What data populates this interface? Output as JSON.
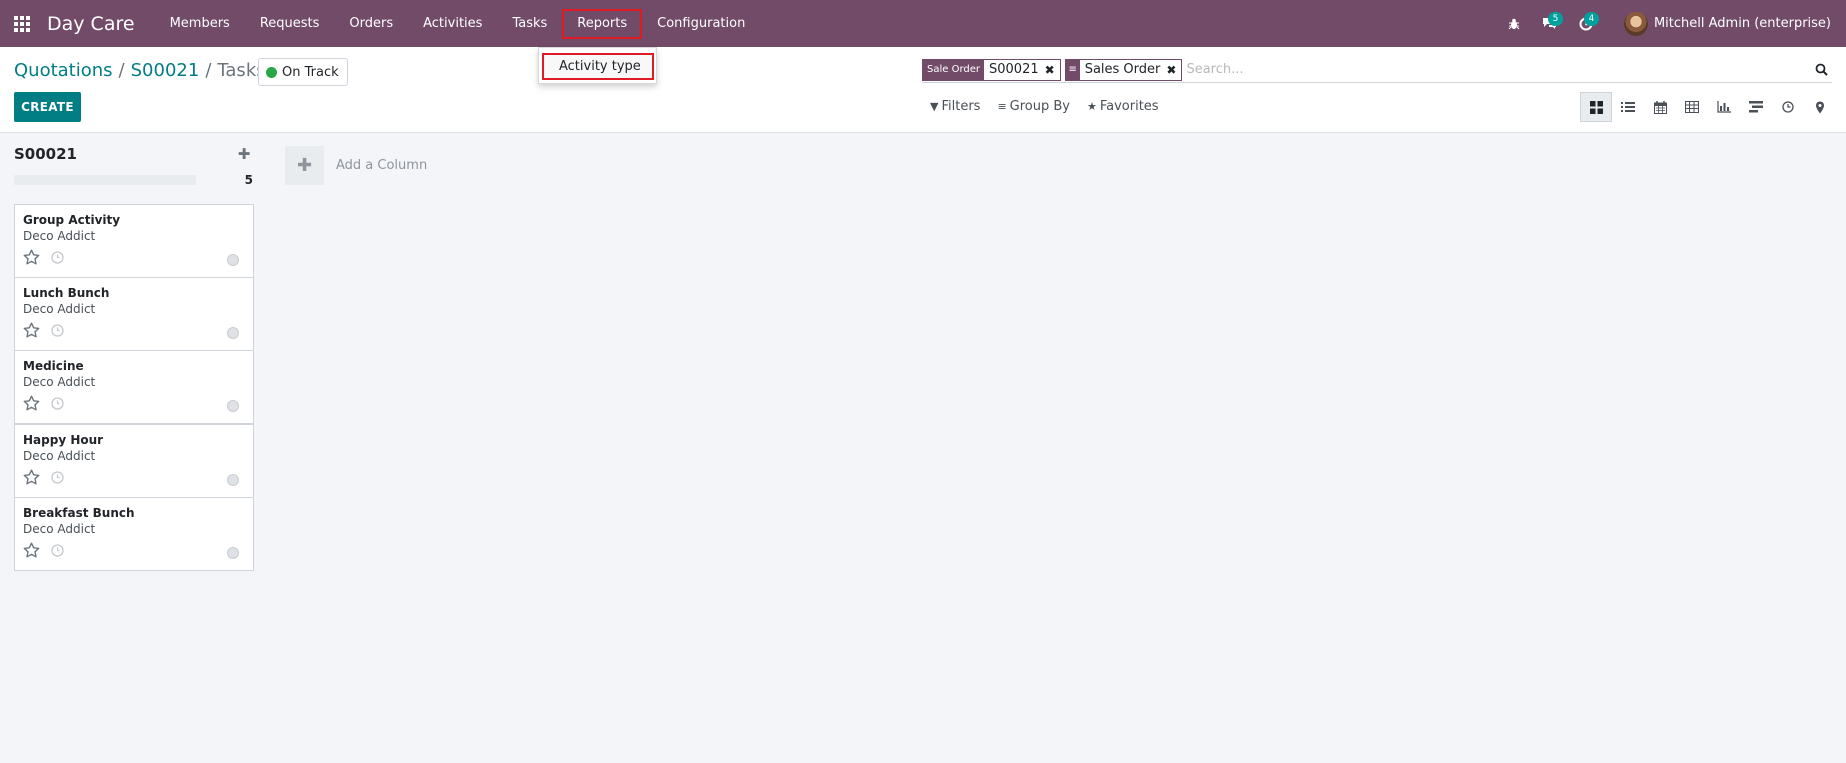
{
  "navbar": {
    "brand": "Day Care",
    "menu": [
      "Members",
      "Requests",
      "Orders",
      "Activities",
      "Tasks",
      "Reports",
      "Configuration"
    ],
    "messages_count": "5",
    "activities_count": "4",
    "user_name": "Mitchell Admin (enterprise)"
  },
  "reports_dropdown": {
    "items": [
      "Activity type"
    ]
  },
  "breadcrumb": {
    "items": [
      "Quotations",
      "S00021",
      "Tasks"
    ],
    "separator": "/"
  },
  "status": {
    "label": "On Track",
    "color": "#28a745"
  },
  "create_label": "CREATE",
  "search": {
    "facets": [
      {
        "label": "Sale Order",
        "value": "S00021"
      },
      {
        "label": "≡",
        "value": "Sales Order"
      }
    ],
    "placeholder": "Search..."
  },
  "filters": {
    "filters": "Filters",
    "group_by": "Group By",
    "favorites": "Favorites"
  },
  "views": [
    "kanban",
    "list",
    "calendar",
    "pivot",
    "graph",
    "gantt",
    "activity",
    "map"
  ],
  "kanban": {
    "column_title": "S00021",
    "column_count": "5",
    "add_column_label": "Add a Column",
    "cards": [
      {
        "title": "Group Activity",
        "customer": "Deco Addict"
      },
      {
        "title": "Lunch Bunch",
        "customer": "Deco Addict"
      },
      {
        "title": "Medicine",
        "customer": "Deco Addict"
      },
      {
        "title": "Happy Hour",
        "customer": "Deco Addict"
      },
      {
        "title": "Breakfast Bunch",
        "customer": "Deco Addict"
      }
    ]
  },
  "colors": {
    "brand": "#714b67",
    "primary": "#017e84",
    "badge": "#00a09d",
    "highlight": "#e01b24"
  }
}
